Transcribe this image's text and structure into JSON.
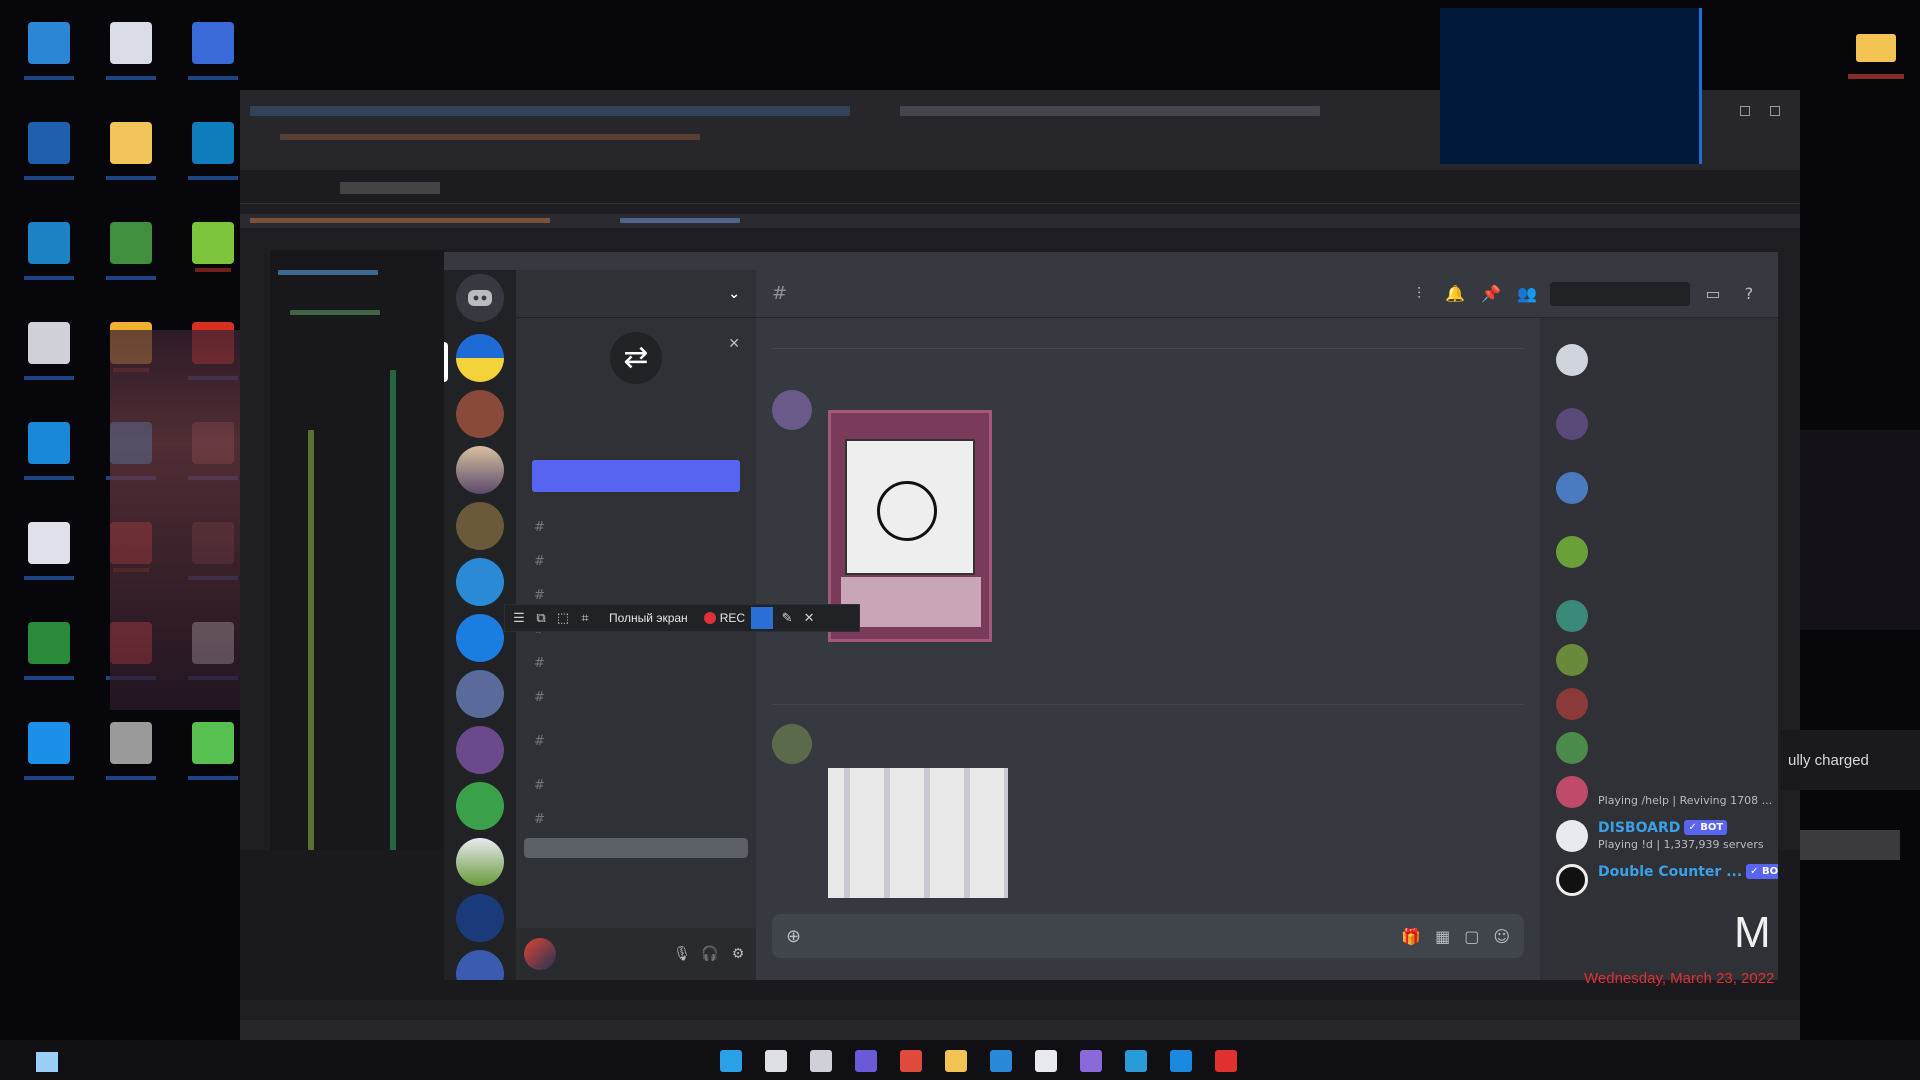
{
  "colors": {
    "discord_bg": "#36393f",
    "discord_sidebar": "#2f3136",
    "discord_rail": "#202225",
    "blurple": "#5865f2",
    "rec_red": "#e0303a",
    "date_red": "#e03030"
  },
  "desktop": {
    "icons": [
      "app-icon",
      "app-icon",
      "app-icon",
      "app-icon",
      "folder-icon",
      "app-icon",
      "app-icon",
      "app-icon",
      "app-icon",
      "app-icon",
      "app-icon",
      "app-icon",
      "app-icon",
      "app-icon",
      "app-icon",
      "app-icon",
      "app-icon",
      "app-icon",
      "app-icon",
      "app-icon",
      "app-icon",
      "app-icon",
      "app-icon",
      "app-icon"
    ]
  },
  "recorder": {
    "fullscreen_label": "Полный экран",
    "rec_label": "REC"
  },
  "notification": {
    "battery_text": "ully charged"
  },
  "clock": {
    "time_fragment": "M",
    "date": "Wednesday, March 23, 2022"
  },
  "members": {
    "disboard": {
      "name": "DISBOARD",
      "tag": "✓ BOT",
      "status": "Playing !d | 1,337,939 servers"
    },
    "help_bot": {
      "status": "Playing /help | Reviving 1708 ..."
    },
    "double_counter": {
      "name": "Double Counter ...",
      "tag": "✓ BOT"
    }
  }
}
